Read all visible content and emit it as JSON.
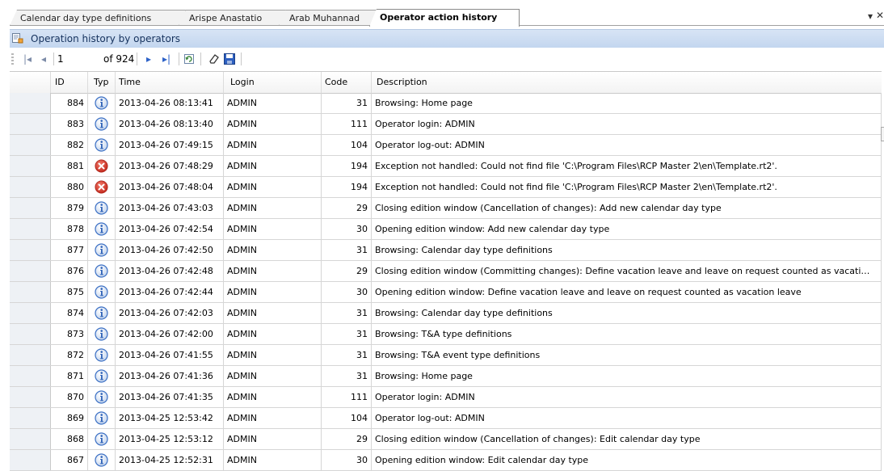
{
  "tabs": [
    {
      "label": "Calendar day type definitions"
    },
    {
      "label": "Arispe Anastatio"
    },
    {
      "label": "Arab Muhannad"
    },
    {
      "label": "Operator action history"
    }
  ],
  "caption": {
    "title": "Operation history by operators"
  },
  "navigator": {
    "position": "1",
    "of_label": "of 924"
  },
  "grid": {
    "columns": {
      "id": "ID",
      "typ": "Typ",
      "time": "Time",
      "login": "Login",
      "code": "Code",
      "description": "Description"
    },
    "rows": [
      {
        "id": "884",
        "type": "info",
        "time": "2013-04-26 08:13:41",
        "login": "ADMIN",
        "code": "31",
        "description": "Browsing: Home page"
      },
      {
        "id": "883",
        "type": "info",
        "time": "2013-04-26 08:13:40",
        "login": "ADMIN",
        "code": "111",
        "description": "Operator login: ADMIN"
      },
      {
        "id": "882",
        "type": "info",
        "time": "2013-04-26 07:49:15",
        "login": "ADMIN",
        "code": "104",
        "description": "Operator log-out: ADMIN"
      },
      {
        "id": "881",
        "type": "error",
        "time": "2013-04-26 07:48:29",
        "login": "ADMIN",
        "code": "194",
        "description": "Exception not handled: Could not find file 'C:\\Program Files\\RCP Master 2\\en\\Template.rt2'."
      },
      {
        "id": "880",
        "type": "error",
        "time": "2013-04-26 07:48:04",
        "login": "ADMIN",
        "code": "194",
        "description": "Exception not handled: Could not find file 'C:\\Program Files\\RCP Master 2\\en\\Template.rt2'."
      },
      {
        "id": "879",
        "type": "info",
        "time": "2013-04-26 07:43:03",
        "login": "ADMIN",
        "code": "29",
        "description": "Closing edition window (Cancellation of changes): Add new calendar day type"
      },
      {
        "id": "878",
        "type": "info",
        "time": "2013-04-26 07:42:54",
        "login": "ADMIN",
        "code": "30",
        "description": "Opening edition window: Add new calendar day type"
      },
      {
        "id": "877",
        "type": "info",
        "time": "2013-04-26 07:42:50",
        "login": "ADMIN",
        "code": "31",
        "description": "Browsing: Calendar day type definitions"
      },
      {
        "id": "876",
        "type": "info",
        "time": "2013-04-26 07:42:48",
        "login": "ADMIN",
        "code": "29",
        "description": "Closing edition window (Committing changes): Define vacation leave and leave on request counted as vacati…"
      },
      {
        "id": "875",
        "type": "info",
        "time": "2013-04-26 07:42:44",
        "login": "ADMIN",
        "code": "30",
        "description": "Opening edition window: Define vacation leave and leave on request counted as vacation leave"
      },
      {
        "id": "874",
        "type": "info",
        "time": "2013-04-26 07:42:03",
        "login": "ADMIN",
        "code": "31",
        "description": "Browsing: Calendar day type definitions"
      },
      {
        "id": "873",
        "type": "info",
        "time": "2013-04-26 07:42:00",
        "login": "ADMIN",
        "code": "31",
        "description": "Browsing: T&A type definitions"
      },
      {
        "id": "872",
        "type": "info",
        "time": "2013-04-26 07:41:55",
        "login": "ADMIN",
        "code": "31",
        "description": "Browsing: T&A event type definitions"
      },
      {
        "id": "871",
        "type": "info",
        "time": "2013-04-26 07:41:36",
        "login": "ADMIN",
        "code": "31",
        "description": "Browsing: Home page"
      },
      {
        "id": "870",
        "type": "info",
        "time": "2013-04-26 07:41:35",
        "login": "ADMIN",
        "code": "111",
        "description": "Operator login: ADMIN"
      },
      {
        "id": "869",
        "type": "info",
        "time": "2013-04-25 12:53:42",
        "login": "ADMIN",
        "code": "104",
        "description": "Operator log-out: ADMIN"
      },
      {
        "id": "868",
        "type": "info",
        "time": "2013-04-25 12:53:12",
        "login": "ADMIN",
        "code": "29",
        "description": "Closing edition window (Cancellation of changes): Edit calendar day type"
      },
      {
        "id": "867",
        "type": "info",
        "time": "2013-04-25 12:52:31",
        "login": "ADMIN",
        "code": "30",
        "description": "Opening edition window: Edit calendar day type"
      }
    ]
  },
  "icons": {
    "info": "info-icon",
    "error": "error-icon"
  },
  "colors": {
    "caption_bg": "#c9daf1",
    "info_blue": "#3a6fc4",
    "error_red": "#d93a2b"
  }
}
